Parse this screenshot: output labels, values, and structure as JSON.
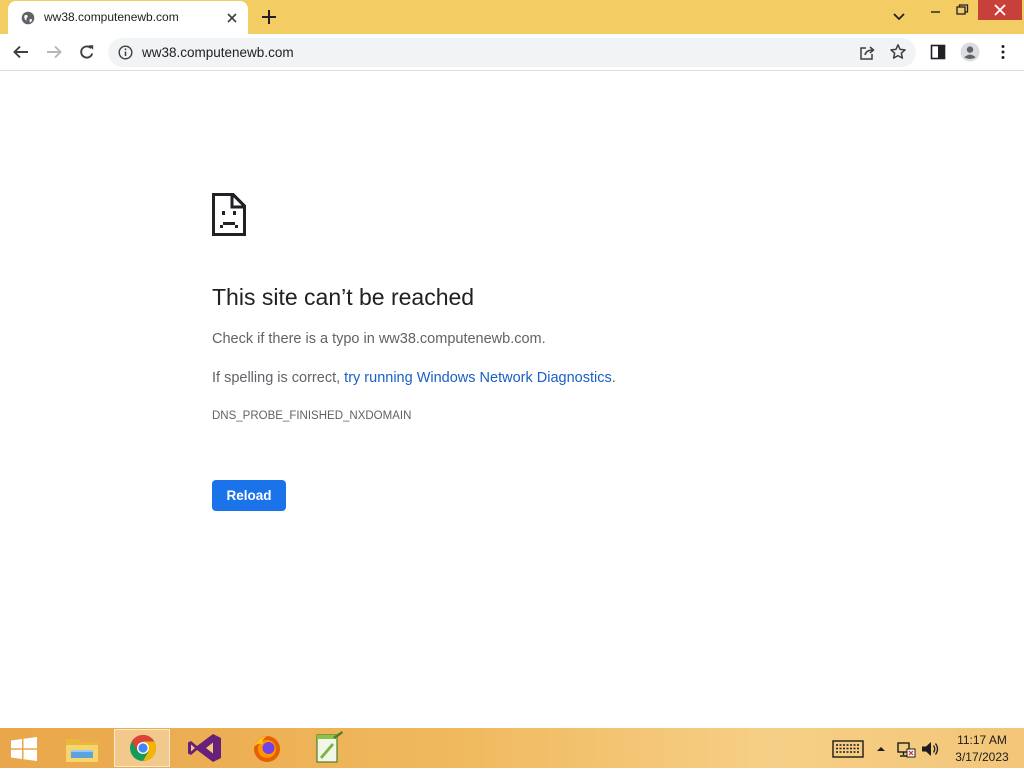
{
  "browser": {
    "tab": {
      "title": "ww38.computenewb.com"
    },
    "address_bar": {
      "url": "ww38.computenewb.com"
    }
  },
  "error_page": {
    "heading": "This site can’t be reached",
    "typo_message": "Check if there is a typo in ww38.computenewb.com.",
    "spelling_prefix": "If spelling is correct, ",
    "diagnostics_link": "try running Windows Network Diagnostics",
    "spelling_suffix": ".",
    "error_code": "DNS_PROBE_FINISHED_NXDOMAIN",
    "reload_label": "Reload"
  },
  "taskbar": {
    "apps": [
      "file-explorer-icon",
      "chrome-icon",
      "visual-studio-icon",
      "firefox-icon",
      "notepad-plus-plus-icon"
    ],
    "active_app": "chrome-icon",
    "clock": {
      "time": "11:17 AM",
      "date": "3/17/2023"
    }
  },
  "colors": {
    "titlebar": "#f4cc64",
    "accent": "#1a73e8",
    "link": "#1a5fc4",
    "close_button": "#c8403a"
  }
}
